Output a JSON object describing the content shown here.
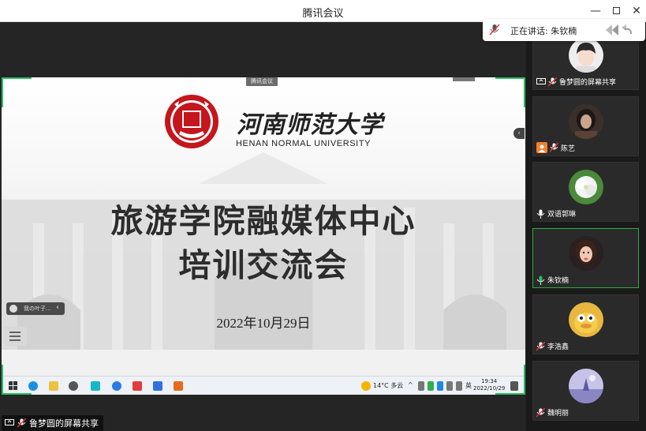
{
  "window": {
    "title": "腾讯会议"
  },
  "speaking": {
    "label": "正在讲话: 朱钦楠"
  },
  "slide": {
    "logo_cn": "河南师范大学",
    "logo_en": "HENAN NORMAL UNIVERSITY",
    "seal_text_top": "河南",
    "seal_text_bottom": "师范大学",
    "title_line1": "旅游学院融媒体中心",
    "title_line2": "培训交流会",
    "date": "2022年10月29日",
    "share_tag": "腾讯会议"
  },
  "float_pill": {
    "text": "我の叶子..."
  },
  "taskbar": {
    "weather": "14°C 多云",
    "lang": "英",
    "time": "19:34",
    "date": "2022/10/29"
  },
  "share_label": {
    "text": "鲁梦圆的屏幕共享"
  },
  "participants": [
    {
      "name": "鲁梦圆的屏幕共享",
      "avatar": "boy-portrait",
      "sharing": true,
      "speaking": false
    },
    {
      "name": "陈艺",
      "avatar": "dark-portrait",
      "host": true,
      "speaking": false
    },
    {
      "name": "双语郭琳",
      "avatar": "flower",
      "speaking": false
    },
    {
      "name": "朱钦楠",
      "avatar": "girl-portrait",
      "speaking": true
    },
    {
      "name": "李浩鑫",
      "avatar": "cartoon-duck",
      "speaking": false
    },
    {
      "name": "魏明丽",
      "avatar": "purple-scene",
      "speaking": false
    }
  ],
  "colors": {
    "accent_green": "#27c063",
    "active_border": "#2ea84c",
    "host_orange": "#f2812b"
  }
}
